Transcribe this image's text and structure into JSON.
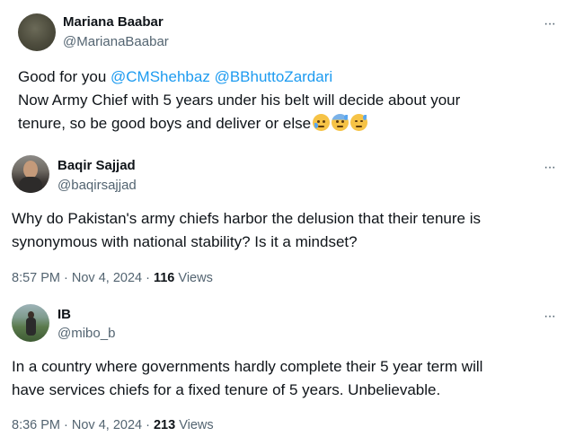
{
  "tweets": [
    {
      "name": "Mariana Baabar",
      "handle": "@MarianaBaabar",
      "line1_prefix": "Good for you ",
      "mention1": "@CMShehbaz",
      "mention2": "@BBhuttoZardari",
      "line2": "Now Army Chief with 5 years under his belt will decide about your",
      "line3": "tenure, so be good boys and deliver or else",
      "emojis": [
        "sad-but-relieved-face-emoji",
        "anxious-face-with-sweat-emoji",
        "downcast-face-with-sweat-emoji"
      ],
      "more": "···"
    },
    {
      "name": "Baqir Sajjad",
      "handle": "@baqirsajjad",
      "line1": "Why do Pakistan's army chiefs harbor the delusion that their tenure is",
      "line2": "synonymous with national stability? Is it a mindset?",
      "time": "8:57 PM · Nov 4, 2024 · ",
      "views_count": "116",
      "views_label": " Views",
      "more": "···"
    },
    {
      "name": "IB",
      "handle": "@mibo_b",
      "line1": "In a country where governments hardly complete their 5 year term will",
      "line2": "have services chiefs for a fixed tenure of 5 years. Unbelievable.",
      "time": "8:36 PM · Nov 4, 2024 · ",
      "views_count": "213",
      "views_label": " Views",
      "more": "···"
    }
  ],
  "colors": {
    "text": "#0f1419",
    "secondary": "#536471",
    "link": "#1d9bf0"
  }
}
